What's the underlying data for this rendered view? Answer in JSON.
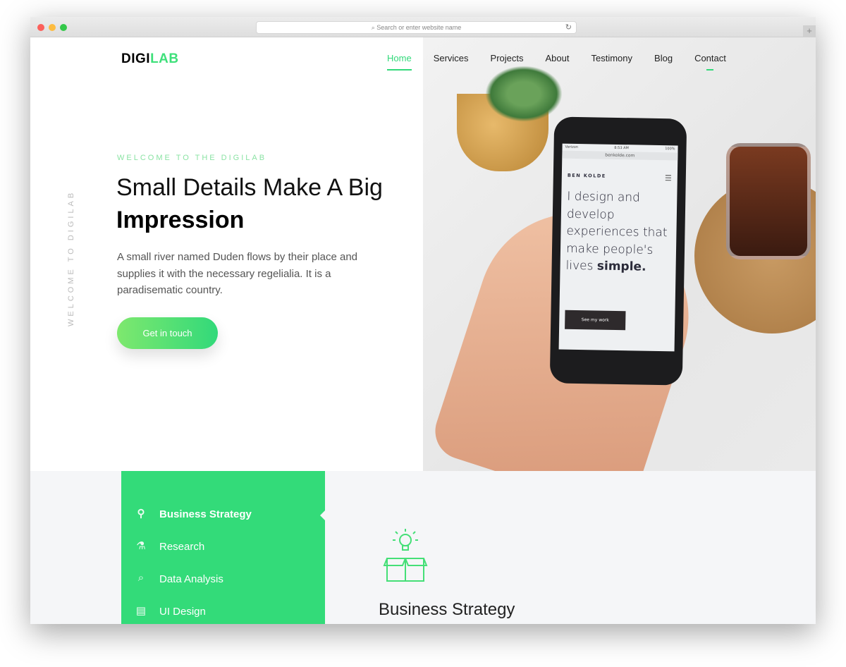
{
  "browser": {
    "url_placeholder": "Search or enter website name",
    "reload": "↻",
    "new_tab": "+"
  },
  "header": {
    "logo_a": "DIGI",
    "logo_b": "LAB",
    "nav": [
      {
        "label": "Home",
        "active": true
      },
      {
        "label": "Services"
      },
      {
        "label": "Projects"
      },
      {
        "label": "About"
      },
      {
        "label": "Testimony"
      },
      {
        "label": "Blog"
      },
      {
        "label": "Contact"
      }
    ]
  },
  "hero": {
    "vertical_text": "WELCOME TO DIGILAB",
    "kicker": "WELCOME TO THE DIGILAB",
    "title_line1": "Small Details Make A Big",
    "title_line2": "Impression",
    "paragraph": "A small river named Duden flows by their place and supplies it with the necessary regelialia. It is a paradisematic country.",
    "cta": "Get in touch"
  },
  "phone": {
    "carrier": "Verizon",
    "time": "8:53 AM",
    "battery": "100%",
    "url": "benkolde.com",
    "brand": "BEN KOLDE",
    "tagline": "I design and develop experiences that make people's lives",
    "tagline_bold": "simple.",
    "button": "See my work"
  },
  "services": {
    "tabs": [
      {
        "label": "Business Strategy",
        "icon": "idea-box-icon",
        "active": true
      },
      {
        "label": "Research",
        "icon": "flask-icon"
      },
      {
        "label": "Data Analysis",
        "icon": "magnifier-chart-icon"
      },
      {
        "label": "UI Design",
        "icon": "design-layout-icon"
      }
    ],
    "active_title": "Business Strategy"
  },
  "colors": {
    "accent": "#33db79",
    "text": "#222222"
  }
}
